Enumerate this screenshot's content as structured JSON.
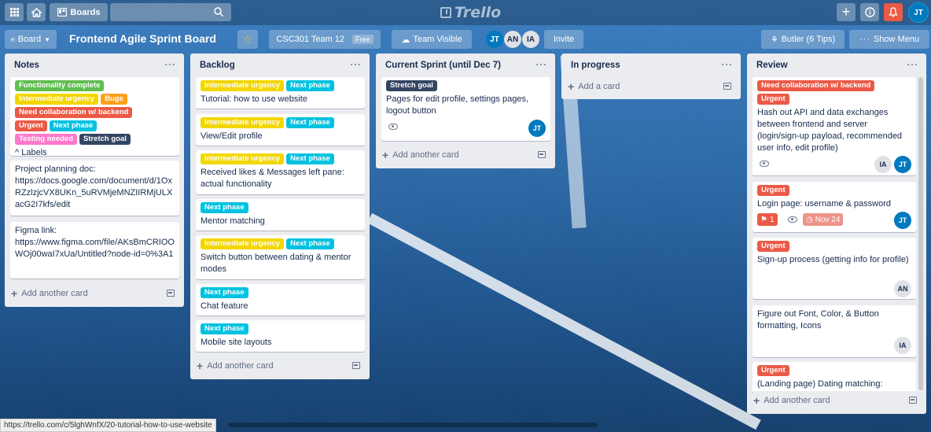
{
  "colors": {
    "green": "#61bd4f",
    "yellow": "#f2d600",
    "orange": "#ff9f1a",
    "red": "#eb5a46",
    "sky": "#00c2e0",
    "pink": "#ff78cb",
    "navy": "#344563",
    "avatar_teal": "#0079bf",
    "notif_red": "#eb5a46"
  },
  "header": {
    "boards_label": "Boards",
    "logo_text": "Trello",
    "user_initials": "JT",
    "icons": [
      "apps-icon",
      "home-icon",
      "board-icon",
      "search-icon",
      "plus-icon",
      "info-icon",
      "bell-icon"
    ]
  },
  "board": {
    "view_label": "Board",
    "title": "Frontend Agile Sprint Board",
    "team_label": "CSC301 Team 12",
    "team_plan": "Free",
    "visibility_label": "Team Visible",
    "members": [
      "JT",
      "AN",
      "IA"
    ],
    "invite_label": "Invite",
    "butler_label": "Butler (6 Tips)",
    "show_menu_label": "Show Menu"
  },
  "lists": {
    "notes": {
      "title": "Notes",
      "add_label": "Add another card",
      "card1": {
        "labels": [
          "Functionality complete",
          "Intermediate urgency",
          "Bugs",
          "Need collaboration w/ backend",
          "Urgent",
          "Next phase",
          "Testing needed",
          "Stretch goal"
        ],
        "text": "^ Labels"
      },
      "card2": {
        "text": "Project planning doc: https://docs.google.com/document/d/1OxRZzlzjcVX8UKn_5uRVMjeMNZIIRMjULXacG2I7kfs/edit"
      },
      "card3": {
        "text": "Figma link: https://www.figma.com/file/AKsBmCRIOOWOj00waI7xUa/Untitled?node-id=0%3A1"
      }
    },
    "backlog": {
      "title": "Backlog",
      "add_label": "Add another card",
      "cards": [
        {
          "labels": [
            "Intermediate urgency",
            "Next phase"
          ],
          "text": "Tutorial: how to use website"
        },
        {
          "labels": [
            "Intermediate urgency",
            "Next phase"
          ],
          "text": "View/Edit profile"
        },
        {
          "labels": [
            "Intermediate urgency",
            "Next phase"
          ],
          "text": "Received likes & Messages left pane: actual functionality"
        },
        {
          "labels": [
            "Next phase"
          ],
          "text": "Mentor matching"
        },
        {
          "labels": [
            "Intermediate urgency",
            "Next phase"
          ],
          "text": "Switch button between dating & mentor modes"
        },
        {
          "labels": [
            "Next phase"
          ],
          "text": "Chat feature"
        },
        {
          "labels": [
            "Next phase"
          ],
          "text": "Mobile site layouts"
        }
      ]
    },
    "current": {
      "title": "Current Sprint (until Dec 7)",
      "add_label": "Add another card",
      "card1": {
        "labels": [
          "Stretch goal"
        ],
        "text": "Pages for edit profile, settings pages, logout button",
        "member": "JT"
      }
    },
    "inprogress": {
      "title": "In progress",
      "add_label": "Add a card"
    },
    "review": {
      "title": "Review",
      "add_label": "Add another card",
      "card1": {
        "labels": [
          "Need collaboration w/ backend",
          "Urgent"
        ],
        "text": "Hash out API and data exchanges between frontend and server (login/sign-up payload, recommended user info, edit profile)",
        "members": [
          "IA",
          "JT"
        ]
      },
      "card2": {
        "labels": [
          "Urgent"
        ],
        "text": "Login page: username & password",
        "notif_count": "1",
        "due": "Nov 24",
        "member": "JT"
      },
      "card3": {
        "labels": [
          "Urgent"
        ],
        "text": "Sign-up process (getting info for profile)",
        "member": "AN"
      },
      "card4": {
        "text": "Figure out Font, Color, & Button formatting, Icons",
        "member": "IA"
      },
      "card5": {
        "labels": [
          "Urgent"
        ],
        "text": "(Landing page) Dating matching:"
      }
    }
  },
  "status_url": "https://trello.com/c/5lghWnfX/20-tutorial-how-to-use-website"
}
